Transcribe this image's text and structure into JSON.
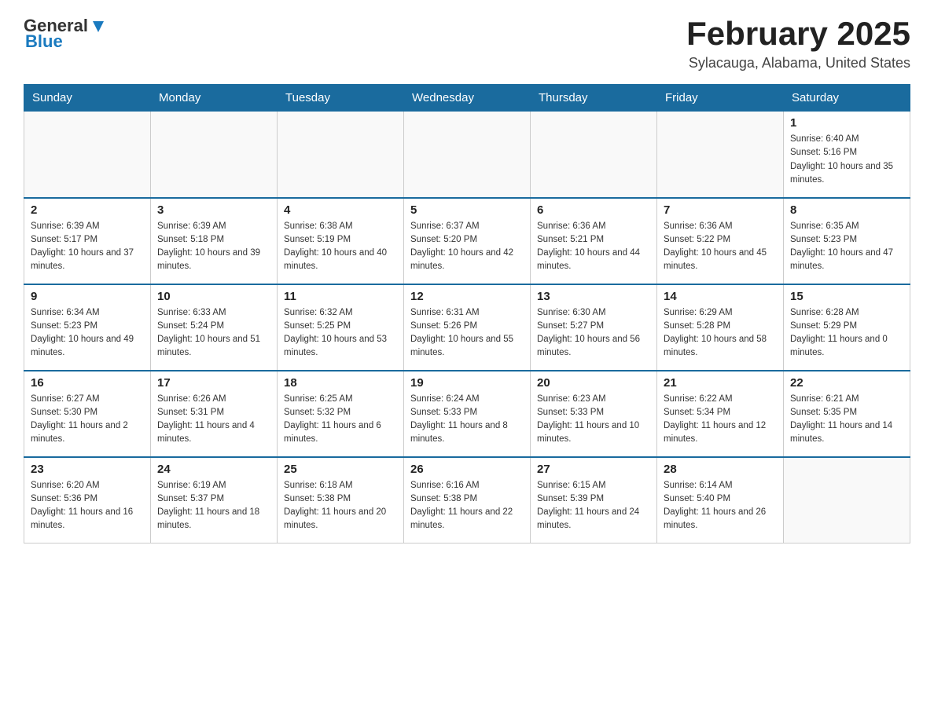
{
  "header": {
    "logo": {
      "general": "General",
      "blue": "Blue"
    },
    "title": "February 2025",
    "location": "Sylacauga, Alabama, United States"
  },
  "days_of_week": [
    "Sunday",
    "Monday",
    "Tuesday",
    "Wednesday",
    "Thursday",
    "Friday",
    "Saturday"
  ],
  "weeks": [
    [
      {
        "day": "",
        "sunrise": "",
        "sunset": "",
        "daylight": ""
      },
      {
        "day": "",
        "sunrise": "",
        "sunset": "",
        "daylight": ""
      },
      {
        "day": "",
        "sunrise": "",
        "sunset": "",
        "daylight": ""
      },
      {
        "day": "",
        "sunrise": "",
        "sunset": "",
        "daylight": ""
      },
      {
        "day": "",
        "sunrise": "",
        "sunset": "",
        "daylight": ""
      },
      {
        "day": "",
        "sunrise": "",
        "sunset": "",
        "daylight": ""
      },
      {
        "day": "1",
        "sunrise": "Sunrise: 6:40 AM",
        "sunset": "Sunset: 5:16 PM",
        "daylight": "Daylight: 10 hours and 35 minutes."
      }
    ],
    [
      {
        "day": "2",
        "sunrise": "Sunrise: 6:39 AM",
        "sunset": "Sunset: 5:17 PM",
        "daylight": "Daylight: 10 hours and 37 minutes."
      },
      {
        "day": "3",
        "sunrise": "Sunrise: 6:39 AM",
        "sunset": "Sunset: 5:18 PM",
        "daylight": "Daylight: 10 hours and 39 minutes."
      },
      {
        "day": "4",
        "sunrise": "Sunrise: 6:38 AM",
        "sunset": "Sunset: 5:19 PM",
        "daylight": "Daylight: 10 hours and 40 minutes."
      },
      {
        "day": "5",
        "sunrise": "Sunrise: 6:37 AM",
        "sunset": "Sunset: 5:20 PM",
        "daylight": "Daylight: 10 hours and 42 minutes."
      },
      {
        "day": "6",
        "sunrise": "Sunrise: 6:36 AM",
        "sunset": "Sunset: 5:21 PM",
        "daylight": "Daylight: 10 hours and 44 minutes."
      },
      {
        "day": "7",
        "sunrise": "Sunrise: 6:36 AM",
        "sunset": "Sunset: 5:22 PM",
        "daylight": "Daylight: 10 hours and 45 minutes."
      },
      {
        "day": "8",
        "sunrise": "Sunrise: 6:35 AM",
        "sunset": "Sunset: 5:23 PM",
        "daylight": "Daylight: 10 hours and 47 minutes."
      }
    ],
    [
      {
        "day": "9",
        "sunrise": "Sunrise: 6:34 AM",
        "sunset": "Sunset: 5:23 PM",
        "daylight": "Daylight: 10 hours and 49 minutes."
      },
      {
        "day": "10",
        "sunrise": "Sunrise: 6:33 AM",
        "sunset": "Sunset: 5:24 PM",
        "daylight": "Daylight: 10 hours and 51 minutes."
      },
      {
        "day": "11",
        "sunrise": "Sunrise: 6:32 AM",
        "sunset": "Sunset: 5:25 PM",
        "daylight": "Daylight: 10 hours and 53 minutes."
      },
      {
        "day": "12",
        "sunrise": "Sunrise: 6:31 AM",
        "sunset": "Sunset: 5:26 PM",
        "daylight": "Daylight: 10 hours and 55 minutes."
      },
      {
        "day": "13",
        "sunrise": "Sunrise: 6:30 AM",
        "sunset": "Sunset: 5:27 PM",
        "daylight": "Daylight: 10 hours and 56 minutes."
      },
      {
        "day": "14",
        "sunrise": "Sunrise: 6:29 AM",
        "sunset": "Sunset: 5:28 PM",
        "daylight": "Daylight: 10 hours and 58 minutes."
      },
      {
        "day": "15",
        "sunrise": "Sunrise: 6:28 AM",
        "sunset": "Sunset: 5:29 PM",
        "daylight": "Daylight: 11 hours and 0 minutes."
      }
    ],
    [
      {
        "day": "16",
        "sunrise": "Sunrise: 6:27 AM",
        "sunset": "Sunset: 5:30 PM",
        "daylight": "Daylight: 11 hours and 2 minutes."
      },
      {
        "day": "17",
        "sunrise": "Sunrise: 6:26 AM",
        "sunset": "Sunset: 5:31 PM",
        "daylight": "Daylight: 11 hours and 4 minutes."
      },
      {
        "day": "18",
        "sunrise": "Sunrise: 6:25 AM",
        "sunset": "Sunset: 5:32 PM",
        "daylight": "Daylight: 11 hours and 6 minutes."
      },
      {
        "day": "19",
        "sunrise": "Sunrise: 6:24 AM",
        "sunset": "Sunset: 5:33 PM",
        "daylight": "Daylight: 11 hours and 8 minutes."
      },
      {
        "day": "20",
        "sunrise": "Sunrise: 6:23 AM",
        "sunset": "Sunset: 5:33 PM",
        "daylight": "Daylight: 11 hours and 10 minutes."
      },
      {
        "day": "21",
        "sunrise": "Sunrise: 6:22 AM",
        "sunset": "Sunset: 5:34 PM",
        "daylight": "Daylight: 11 hours and 12 minutes."
      },
      {
        "day": "22",
        "sunrise": "Sunrise: 6:21 AM",
        "sunset": "Sunset: 5:35 PM",
        "daylight": "Daylight: 11 hours and 14 minutes."
      }
    ],
    [
      {
        "day": "23",
        "sunrise": "Sunrise: 6:20 AM",
        "sunset": "Sunset: 5:36 PM",
        "daylight": "Daylight: 11 hours and 16 minutes."
      },
      {
        "day": "24",
        "sunrise": "Sunrise: 6:19 AM",
        "sunset": "Sunset: 5:37 PM",
        "daylight": "Daylight: 11 hours and 18 minutes."
      },
      {
        "day": "25",
        "sunrise": "Sunrise: 6:18 AM",
        "sunset": "Sunset: 5:38 PM",
        "daylight": "Daylight: 11 hours and 20 minutes."
      },
      {
        "day": "26",
        "sunrise": "Sunrise: 6:16 AM",
        "sunset": "Sunset: 5:38 PM",
        "daylight": "Daylight: 11 hours and 22 minutes."
      },
      {
        "day": "27",
        "sunrise": "Sunrise: 6:15 AM",
        "sunset": "Sunset: 5:39 PM",
        "daylight": "Daylight: 11 hours and 24 minutes."
      },
      {
        "day": "28",
        "sunrise": "Sunrise: 6:14 AM",
        "sunset": "Sunset: 5:40 PM",
        "daylight": "Daylight: 11 hours and 26 minutes."
      },
      {
        "day": "",
        "sunrise": "",
        "sunset": "",
        "daylight": ""
      }
    ]
  ]
}
